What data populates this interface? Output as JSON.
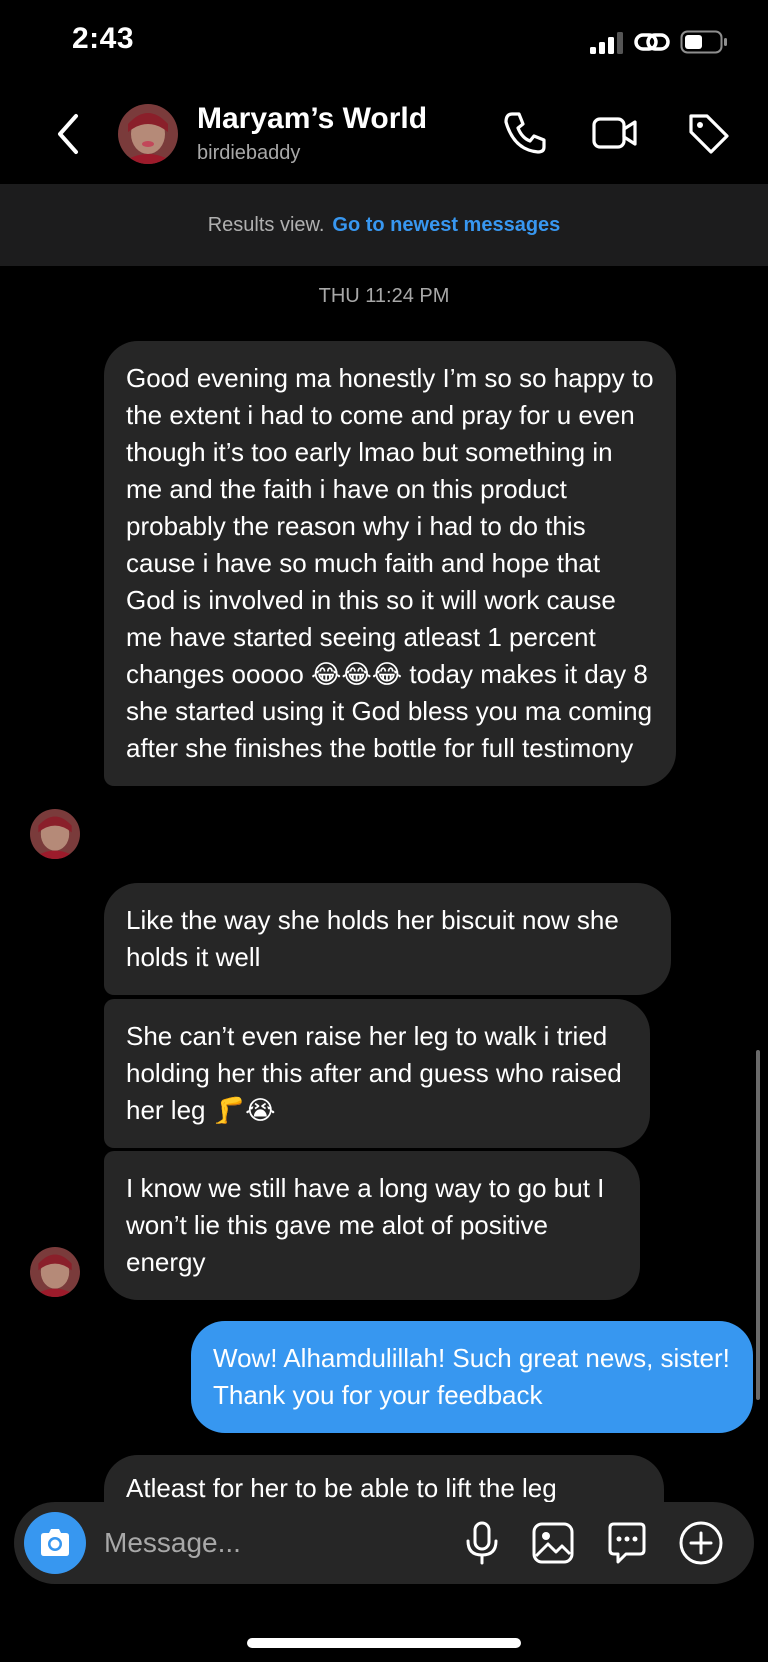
{
  "status_bar": {
    "time": "2:43"
  },
  "header": {
    "name": "Maryam’s World",
    "handle": "birdiebaddy"
  },
  "results_banner": {
    "label": "Results view.",
    "link": "Go to newest messages"
  },
  "timestamp": "THU 11:24 PM",
  "messages": [
    {
      "sender": "them",
      "text": "Good evening ma honestly I’m so so happy to the extent i had to come and pray for u even though it’s too early lmao but something in me and the faith i have on this product probably the reason why i had to do this cause i have so much faith and hope that God is involved in this so it will work cause me have started seeing atleast 1 percent changes ooooo 😂😂😂 today makes it day 8 she started using it God bless you ma coming after she finishes the bottle for full testimony"
    },
    {
      "sender": "them",
      "text": "Like the way she holds her biscuit now she holds it well"
    },
    {
      "sender": "them",
      "text": "She can’t even raise her leg to walk i tried holding her this after and guess who raised her leg 🦵😭"
    },
    {
      "sender": "them",
      "text": "I know we still have a long way to go but I won’t lie this gave me alot of positive energy"
    },
    {
      "sender": "me",
      "text": "Wow! Alhamdulillah! Such great news, sister! Thank you for your feedback"
    },
    {
      "sender": "them",
      "text": "Atleast for her to be able to lift the leg"
    }
  ],
  "composer": {
    "placeholder": "Message..."
  },
  "colors": {
    "accent": "#3797f0",
    "incoming_bubble": "#262626",
    "link": "#3897f0"
  }
}
